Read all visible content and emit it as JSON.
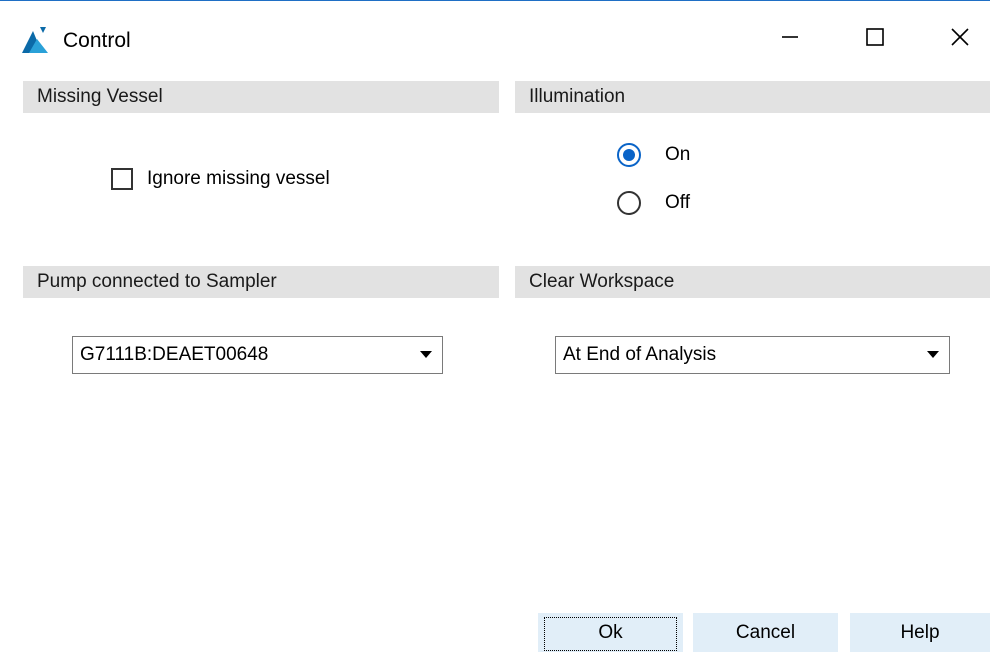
{
  "window": {
    "title": "Control",
    "icon": "agilent-spike-icon",
    "controls": [
      "minimize-icon",
      "maximize-icon",
      "close-icon"
    ]
  },
  "missing_vessel": {
    "header": "Missing Vessel",
    "ignore_label": "Ignore missing vessel",
    "ignore_checked": false
  },
  "illumination": {
    "header": "Illumination",
    "options": [
      {
        "label": "On",
        "selected": true
      },
      {
        "label": "Off",
        "selected": false
      }
    ]
  },
  "pump": {
    "header": "Pump connected to Sampler",
    "selected": "G7111B:DEAET00648"
  },
  "clear_workspace": {
    "header": "Clear Workspace",
    "selected": "At End of Analysis"
  },
  "buttons": {
    "ok": "Ok",
    "cancel": "Cancel",
    "help": "Help"
  },
  "colors": {
    "accent": "#0a64c8",
    "header_bg": "#e2e2e2",
    "button_bg": "#e1eef8"
  }
}
